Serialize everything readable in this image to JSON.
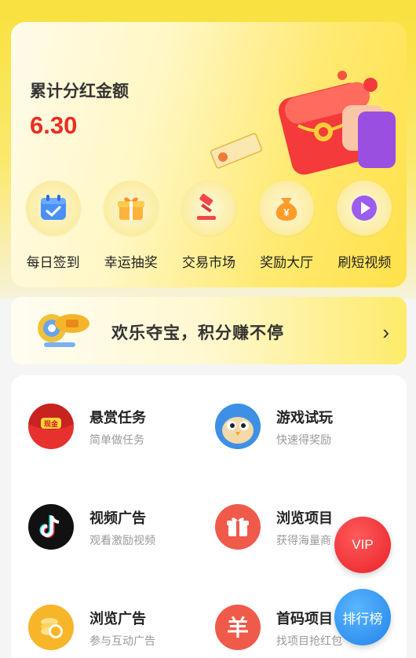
{
  "summary": {
    "title": "累计分红金额",
    "amount": "6.30"
  },
  "quick_actions": [
    {
      "label": "每日签到",
      "icon": "calendar-check-icon"
    },
    {
      "label": "幸运抽奖",
      "icon": "gift-box-icon"
    },
    {
      "label": "交易市场",
      "icon": "gavel-icon"
    },
    {
      "label": "奖励大厅",
      "icon": "money-bag-icon"
    },
    {
      "label": "刷短视频",
      "icon": "play-icon"
    }
  ],
  "banner": {
    "text": "欢乐夺宝，积分赚不停",
    "icon": "treasure-coin-icon",
    "arrow": "chevron-right-icon"
  },
  "tasks": [
    {
      "name": "悬赏任务",
      "desc": "简单做任务",
      "icon": "red-packet-icon",
      "icon_text": "现金"
    },
    {
      "name": "游戏试玩",
      "desc": "快速得奖励",
      "icon": "bird-game-icon"
    },
    {
      "name": "视频广告",
      "desc": "观看激励视频",
      "icon": "tiktok-icon"
    },
    {
      "name": "浏览项目",
      "desc": "获得海量商",
      "icon": "gift-icon"
    },
    {
      "name": "浏览广告",
      "desc": "参与互动广告",
      "icon": "coins-icon"
    },
    {
      "name": "首码项目",
      "desc": "找项目抢红包",
      "icon": "yen-icon",
      "icon_text": "羊"
    }
  ],
  "floating": {
    "vip": "VIP",
    "rank": "排行榜"
  },
  "colors": {
    "accent_yellow": "#f8e13d",
    "amount_red": "#ee2a22",
    "vip_red": "#e8222a",
    "rank_blue": "#2283ea"
  }
}
